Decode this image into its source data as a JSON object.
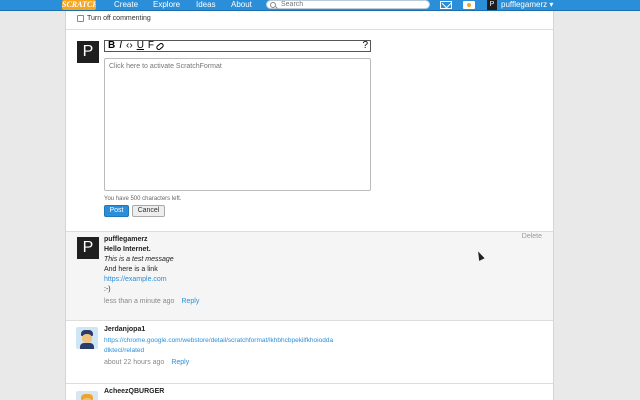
{
  "nav": {
    "logo": "SCRATCH",
    "links": [
      "Create",
      "Explore",
      "Ideas",
      "About"
    ],
    "search_placeholder": "Search",
    "avatar_letter": "P",
    "username": "pufflegamerz ▾"
  },
  "composer": {
    "turn_off_label": "Turn off commenting",
    "avatar_letter": "P",
    "toolbar": {
      "bold": "B",
      "italic": "I",
      "code": "‹›",
      "underline": "U",
      "format": "F",
      "help": "?"
    },
    "placeholder": "Click here to activate ScratchFormat",
    "chars_left": "You have 500 characters left.",
    "post_label": "Post",
    "cancel_label": "Cancel"
  },
  "comments": [
    {
      "avatar_letter": "P",
      "username": "pufflegamerz",
      "lines": [
        "Hello Internet.",
        "This is a test message",
        "And here is a link",
        "https://example.com",
        ":-)"
      ],
      "time": "less than a minute ago",
      "reply_label": "Reply",
      "delete_label": "Delete"
    },
    {
      "username": "Jerdanjopa1",
      "link_line1": "https://chrome.google.com/webstore/detail/scratchformat/lkhbhcbpekilfkhoiodda",
      "link_line2": "dlktecl/related",
      "time": "about 22 hours ago",
      "reply_label": "Reply"
    },
    {
      "username": "AcheezQBURGER"
    }
  ],
  "colors": {
    "accent": "#2a8fd8",
    "nav_bg": "#2a8fd8",
    "logo": "#f5a623"
  }
}
